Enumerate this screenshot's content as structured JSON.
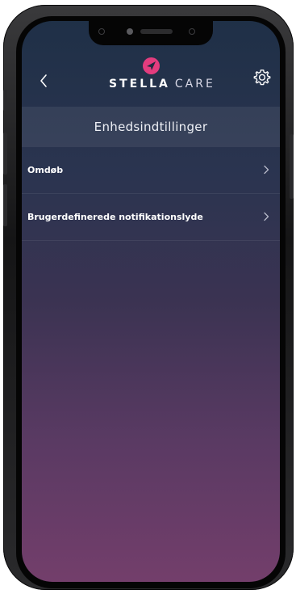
{
  "header": {
    "logo_stella": "STELLA",
    "logo_care": "CARE"
  },
  "page": {
    "title": "Enhedsindtillinger"
  },
  "settings_list": {
    "items": [
      {
        "label": "Omdøb"
      },
      {
        "label": "Brugerdefinerede notifikationslyde"
      }
    ]
  },
  "icons": {
    "back": "chevron-left-icon",
    "settings": "gear-icon",
    "logo": "paper-plane-icon",
    "row_arrow": "chevron-right-icon"
  },
  "colors": {
    "brand_pink": "#e33c7e",
    "gradient_top": "#1f3047",
    "gradient_bottom": "#733e6b"
  }
}
